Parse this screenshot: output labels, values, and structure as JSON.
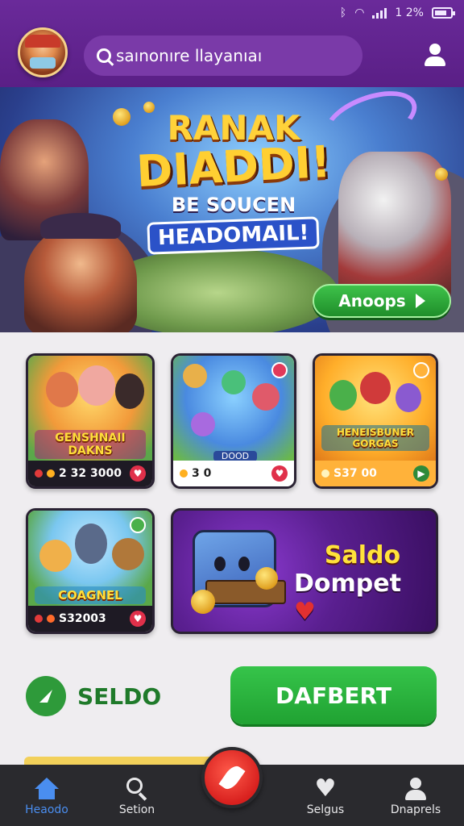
{
  "status_bar": {
    "battery_text": "1 2%"
  },
  "header": {
    "search_placeholder": "saınonıre llayanıaı"
  },
  "hero": {
    "line1": "RANAK",
    "line2": "DIADDI!",
    "line3": "BE SOUCEN",
    "line4": "HEADOMAIL!",
    "cta_label": "Anoops"
  },
  "cards": [
    {
      "title": "GENSHNAII DAKNS",
      "price": "2 32 3000"
    },
    {
      "title": "",
      "price": "3 0",
      "tag": "DOOD"
    },
    {
      "title": "HENEISBUNER GORGAS",
      "price": "S37 00"
    },
    {
      "title": "COAGNEL",
      "price": "S32003"
    }
  ],
  "wallet": {
    "line1": "Saldo",
    "line2": "Dompet",
    "heart": "♥"
  },
  "saldo": {
    "label": "SELDO"
  },
  "deposit": {
    "label": "DAFBERT"
  },
  "nav": {
    "home": "Heaodo",
    "search": "Setion",
    "likes": "Selgus",
    "profile": "Dnaprels"
  },
  "colors": {
    "header": "#5a1f86",
    "accent_green": "#2ea83c",
    "nav_bg": "#2a2a2e",
    "fab": "#e02a24"
  }
}
